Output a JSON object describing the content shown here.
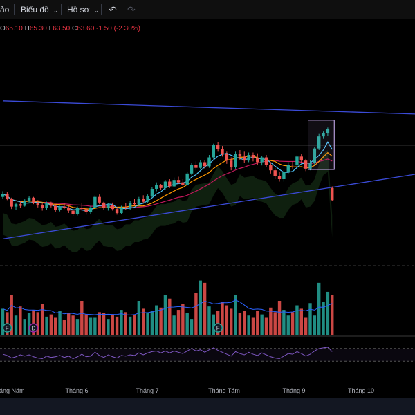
{
  "toolbar": {
    "cut_item": "ảo",
    "chart_menu": "Biểu đồ",
    "profile_menu": "Hồ sơ",
    "undo_icon": "undo-icon",
    "redo_icon": "redo-icon"
  },
  "legend": {
    "o_label": "O",
    "o_value": "65.10",
    "h_label": "H",
    "h_value": "65.30",
    "l_label": "L",
    "l_value": "63.50",
    "c_label": "C",
    "c_value": "63.60",
    "change": "-1.50",
    "change_pct": "(-2.30%)"
  },
  "time_axis": [
    "Tháng Năm",
    "Tháng 6",
    "Tháng 7",
    "Tháng Tám",
    "Tháng 9",
    "Tháng 10"
  ],
  "event_markers": [
    "F",
    "D",
    "F"
  ],
  "colors": {
    "up": "#26a69a",
    "down": "#ef5350",
    "trendline": "#3b4bd8",
    "highlight": "#d6b8ff",
    "rsi": "#7e57c2",
    "volume_ma": "#2962ff",
    "background": "#000000"
  },
  "chart_data": {
    "type": "candlestick",
    "candles": [
      [
        64.0,
        64.7,
        63.8,
        64.4
      ],
      [
        64.4,
        64.6,
        63.6,
        63.8
      ],
      [
        63.8,
        63.9,
        62.5,
        62.8
      ],
      [
        62.8,
        63.3,
        62.4,
        63.1
      ],
      [
        63.1,
        63.5,
        62.6,
        62.9
      ],
      [
        62.9,
        63.7,
        62.8,
        63.5
      ],
      [
        63.5,
        64.1,
        63.2,
        63.9
      ],
      [
        63.9,
        64.0,
        63.1,
        63.3
      ],
      [
        63.3,
        63.6,
        62.7,
        63.0
      ],
      [
        63.0,
        63.2,
        62.3,
        62.6
      ],
      [
        62.6,
        63.4,
        62.4,
        63.2
      ],
      [
        63.2,
        63.4,
        62.7,
        62.9
      ],
      [
        62.9,
        63.1,
        62.1,
        62.4
      ],
      [
        62.4,
        62.9,
        62.2,
        62.8
      ],
      [
        62.8,
        63.2,
        62.5,
        62.6
      ],
      [
        62.6,
        63.0,
        62.0,
        62.3
      ],
      [
        62.3,
        62.5,
        61.6,
        61.9
      ],
      [
        61.9,
        62.8,
        61.7,
        62.6
      ],
      [
        62.6,
        63.2,
        62.3,
        62.5
      ],
      [
        62.5,
        62.7,
        61.8,
        62.1
      ],
      [
        62.1,
        62.9,
        61.9,
        62.7
      ],
      [
        62.7,
        64.2,
        62.6,
        64.0
      ],
      [
        64.0,
        64.3,
        63.1,
        63.3
      ],
      [
        63.3,
        63.4,
        62.4,
        62.6
      ],
      [
        62.6,
        63.2,
        62.3,
        63.0
      ],
      [
        63.0,
        63.3,
        62.3,
        62.5
      ],
      [
        62.5,
        62.7,
        61.8,
        62.0
      ],
      [
        62.0,
        62.9,
        61.9,
        62.7
      ],
      [
        62.7,
        63.2,
        62.4,
        62.6
      ],
      [
        62.6,
        63.5,
        62.4,
        63.2
      ],
      [
        63.2,
        63.8,
        62.9,
        63.1
      ],
      [
        63.1,
        64.0,
        62.9,
        63.8
      ],
      [
        63.8,
        64.2,
        63.2,
        63.4
      ],
      [
        63.4,
        64.3,
        63.3,
        64.1
      ],
      [
        64.1,
        65.2,
        63.9,
        65.0
      ],
      [
        65.0,
        65.8,
        64.7,
        65.5
      ],
      [
        65.5,
        65.6,
        64.9,
        65.1
      ],
      [
        65.1,
        66.1,
        64.9,
        65.9
      ],
      [
        65.9,
        66.2,
        65.1,
        65.3
      ],
      [
        65.3,
        66.4,
        65.2,
        66.1
      ],
      [
        66.1,
        66.5,
        65.6,
        65.8
      ],
      [
        65.8,
        66.2,
        65.3,
        65.5
      ],
      [
        65.5,
        67.1,
        65.4,
        66.9
      ],
      [
        66.9,
        68.2,
        66.7,
        68.0
      ],
      [
        68.0,
        68.4,
        67.3,
        67.6
      ],
      [
        67.6,
        68.6,
        67.4,
        68.3
      ],
      [
        68.3,
        68.6,
        67.5,
        67.8
      ],
      [
        67.8,
        69.2,
        67.6,
        68.9
      ],
      [
        68.9,
        70.6,
        68.7,
        70.4
      ],
      [
        70.4,
        70.8,
        69.6,
        69.9
      ],
      [
        69.9,
        70.3,
        69.0,
        69.3
      ],
      [
        69.3,
        69.6,
        68.1,
        68.5
      ],
      [
        68.5,
        68.9,
        67.3,
        67.7
      ],
      [
        67.7,
        69.6,
        67.5,
        69.3
      ],
      [
        69.3,
        69.8,
        68.6,
        69.0
      ],
      [
        69.0,
        69.6,
        68.2,
        68.5
      ],
      [
        68.5,
        69.5,
        68.3,
        69.2
      ],
      [
        69.2,
        69.5,
        68.4,
        68.8
      ],
      [
        68.8,
        69.4,
        68.0,
        68.3
      ],
      [
        68.3,
        69.1,
        67.9,
        68.9
      ],
      [
        68.9,
        69.2,
        67.7,
        68.0
      ],
      [
        68.0,
        68.3,
        66.9,
        67.3
      ],
      [
        67.3,
        67.6,
        66.2,
        66.6
      ],
      [
        66.6,
        67.1,
        65.9,
        66.2
      ],
      [
        66.2,
        67.3,
        65.9,
        67.1
      ],
      [
        67.1,
        68.3,
        66.9,
        68.0
      ],
      [
        68.0,
        68.4,
        67.5,
        67.9
      ],
      [
        67.9,
        69.2,
        67.7,
        69.0
      ],
      [
        69.0,
        69.3,
        68.2,
        68.5
      ],
      [
        68.5,
        68.7,
        67.2,
        67.5
      ],
      [
        67.5,
        68.6,
        67.3,
        68.2
      ],
      [
        68.2,
        70.2,
        68.0,
        70.0
      ],
      [
        70.0,
        71.8,
        69.8,
        71.5
      ],
      [
        71.5,
        72.1,
        71.2,
        71.9
      ],
      [
        71.9,
        72.6,
        71.6,
        72.4
      ],
      [
        65.1,
        65.3,
        63.5,
        63.6
      ]
    ],
    "volume": [
      46,
      40,
      70,
      34,
      50,
      28,
      38,
      44,
      40,
      55,
      32,
      36,
      30,
      42,
      26,
      38,
      34,
      28,
      60,
      36,
      30,
      30,
      40,
      38,
      28,
      36,
      32,
      44,
      40,
      32,
      36,
      60,
      46,
      38,
      42,
      52,
      48,
      70,
      64,
      34,
      44,
      54,
      38,
      28,
      74,
      96,
      92,
      50,
      36,
      42,
      58,
      52,
      46,
      70,
      38,
      42,
      34,
      30,
      42,
      36,
      30,
      48,
      40,
      60,
      44,
      34,
      40,
      52,
      46,
      30,
      56,
      34,
      92,
      58,
      76,
      70
    ],
    "rsi": [
      52,
      48,
      40,
      44,
      50,
      46,
      50,
      44,
      40,
      38,
      46,
      42,
      44,
      48,
      42,
      46,
      38,
      44,
      52,
      44,
      46,
      58,
      48,
      42,
      50,
      44,
      40,
      48,
      46,
      50,
      48,
      56,
      50,
      56,
      60,
      62,
      56,
      62,
      56,
      62,
      58,
      54,
      62,
      70,
      62,
      66,
      58,
      66,
      72,
      64,
      58,
      52,
      46,
      60,
      54,
      50,
      58,
      52,
      48,
      56,
      50,
      44,
      40,
      38,
      46,
      54,
      52,
      60,
      54,
      46,
      52,
      62,
      70,
      72,
      74,
      60
    ],
    "trendlines": [
      {
        "p1": [
          0,
          75.9
        ],
        "p2": [
          115,
          73.9
        ]
      },
      {
        "p1": [
          0,
          58.8
        ],
        "p2": [
          115,
          68.6
        ]
      }
    ],
    "highlight_range": {
      "x": [
        70,
        75
      ],
      "y": [
        67.4,
        73.5
      ]
    },
    "price_range": [
      56,
      80
    ],
    "volume_range": [
      0,
      120
    ],
    "rsi_range": [
      0,
      100
    ]
  }
}
